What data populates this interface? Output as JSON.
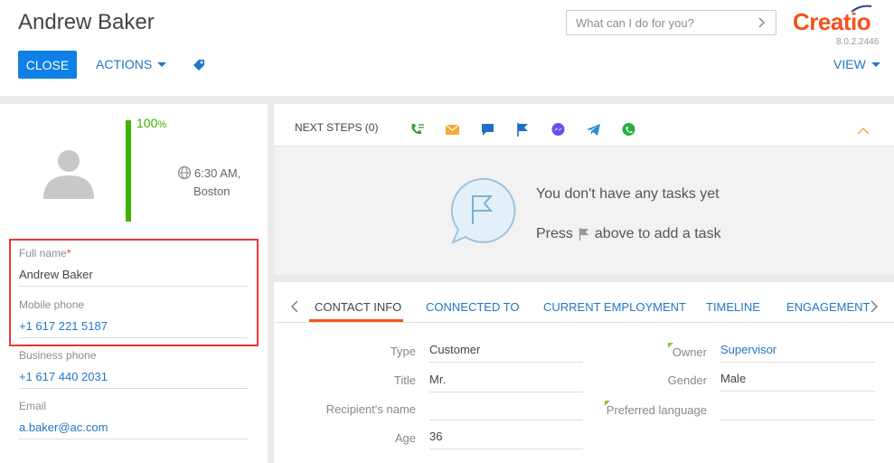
{
  "header": {
    "title": "Andrew Baker",
    "close_label": "CLOSE",
    "actions_label": "ACTIONS",
    "view_label": "VIEW",
    "search_placeholder": "What can I do for you?",
    "logo_text": "Creatio",
    "version": "8.0.2.2446"
  },
  "profile": {
    "completeness_percent": 100,
    "completeness_number": "100",
    "completeness_unit": "%",
    "local_time": "6:30 AM,",
    "city": "Boston"
  },
  "fields": {
    "full_name_label": "Full name",
    "full_name_required": "*",
    "full_name_value": "Andrew Baker",
    "mobile_label": "Mobile phone",
    "mobile_value": "+1 617 221 5187",
    "business_label": "Business phone",
    "business_value": "+1 617 440 2031",
    "email_label": "Email",
    "email_value": "a.baker@ac.com"
  },
  "next_steps": {
    "title": "NEXT STEPS (0)",
    "channel_icons": [
      "phone-task-icon",
      "email-icon",
      "chat-icon",
      "flag-icon",
      "messenger-icon",
      "telegram-icon",
      "whatsapp-icon"
    ],
    "empty_line1": "You don't have any tasks yet",
    "empty_line2_before": "Press",
    "empty_line2_after": "above to add a task"
  },
  "tabs": {
    "items": [
      "CONTACT INFO",
      "CONNECTED TO",
      "CURRENT EMPLOYMENT",
      "TIMELINE",
      "ENGAGEMENT"
    ],
    "active": "CONTACT INFO"
  },
  "contact_info": {
    "type_label": "Type",
    "type_value": "Customer",
    "title_label": "Title",
    "title_value": "Mr.",
    "recipient_label": "Recipient's name",
    "recipient_value": "",
    "age_label": "Age",
    "age_value": "36",
    "owner_label": "Owner",
    "owner_value": "Supervisor",
    "gender_label": "Gender",
    "gender_value": "Male",
    "language_label": "Preferred language",
    "language_value": ""
  },
  "colors": {
    "accent": "#0e80e6",
    "link": "#2177c6",
    "brand": "#f4521e",
    "progress": "#3db200",
    "highlight": "#e53935"
  }
}
